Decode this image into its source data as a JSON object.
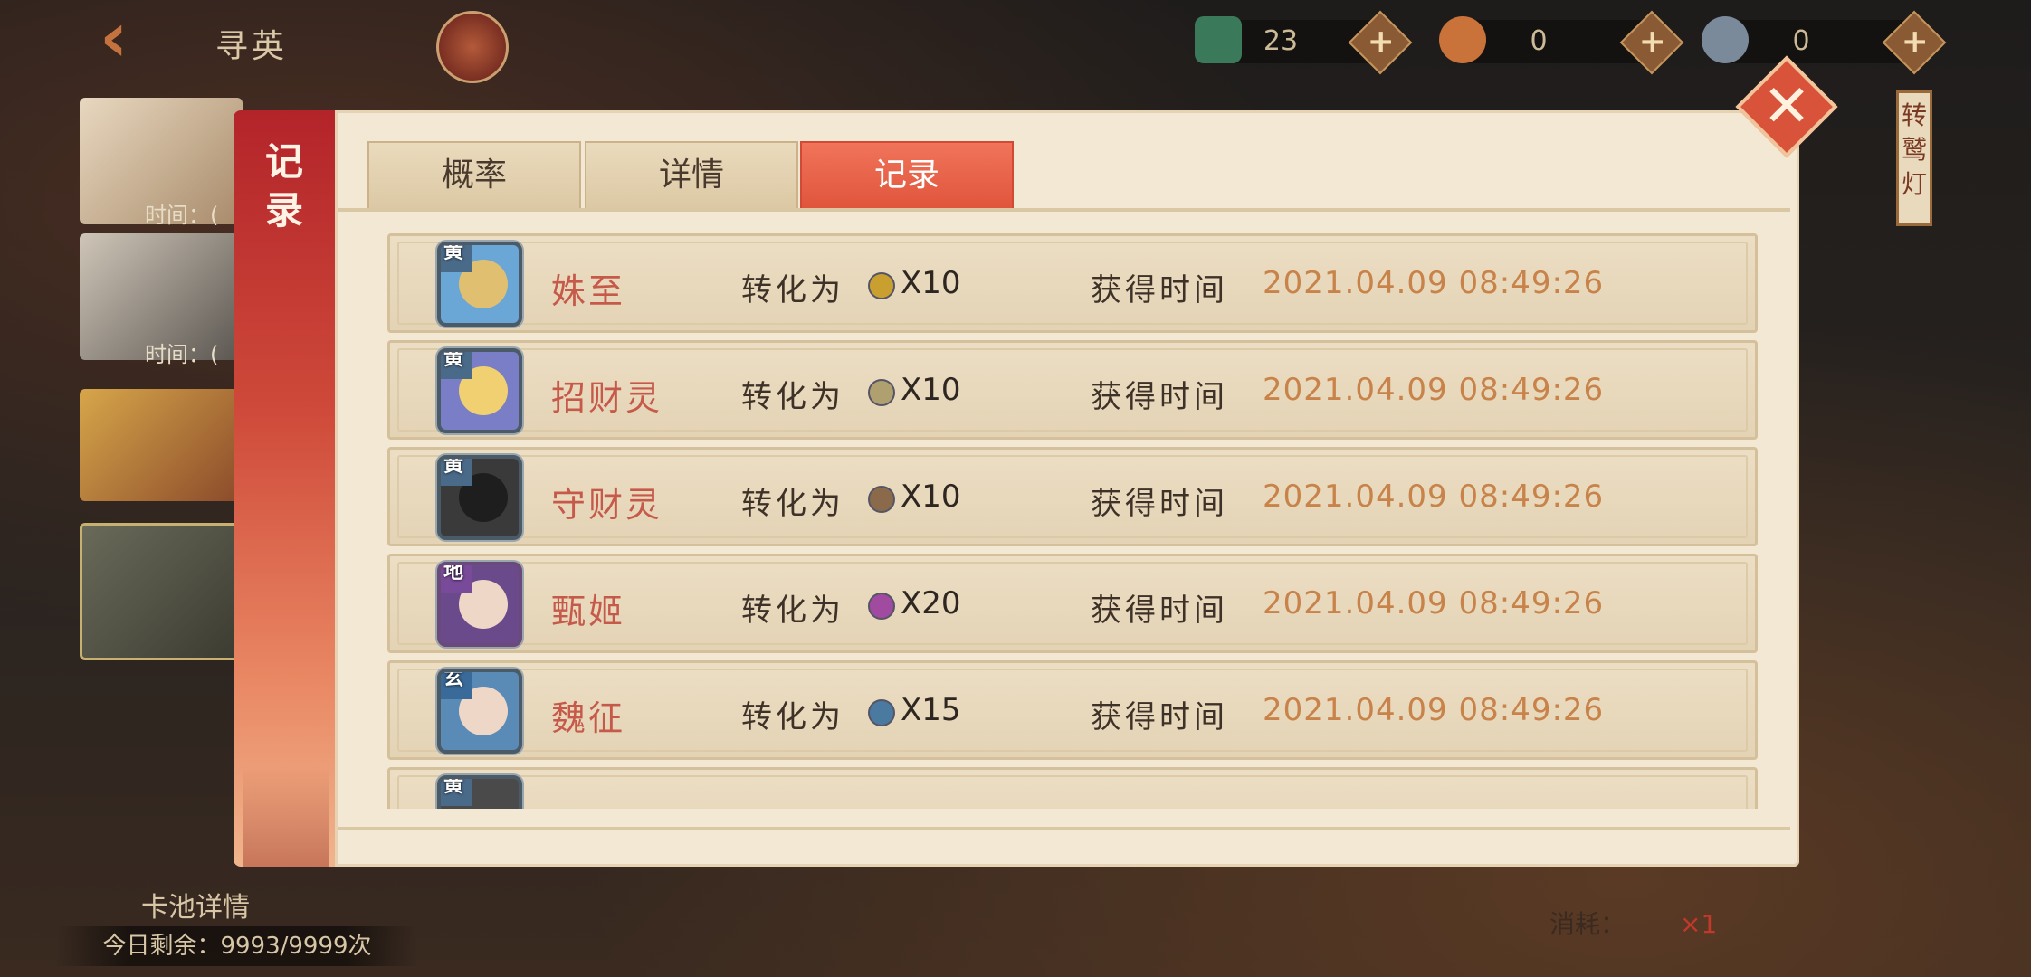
{
  "header": {
    "title": "寻英",
    "resources": [
      {
        "icon": "jade-token-icon",
        "value": "23",
        "color": "#3a7a5a"
      },
      {
        "icon": "fox-spirit-icon",
        "value": "0",
        "color": "#c9733a"
      },
      {
        "icon": "cat-spirit-icon",
        "value": "0",
        "color": "#7a8a9a"
      }
    ],
    "plus_label": "+"
  },
  "sidebar": {
    "time_label_1": "时间：(",
    "time_label_2": "时间：("
  },
  "right_deco": {
    "label": "转\n鹫\n灯"
  },
  "bottom": {
    "card_pool_label": "卡池详情",
    "remaining": "今日剩余：9993/9999次",
    "consume_label": "消耗：",
    "consume_count": "×1"
  },
  "modal": {
    "side_title": "记\n录",
    "close_symbol": "✕",
    "tabs": [
      {
        "label": "概率",
        "active": false
      },
      {
        "label": "详情",
        "active": false
      },
      {
        "label": "记录",
        "active": true
      }
    ],
    "records": [
      {
        "rarity": "黄",
        "name": "姝至",
        "convert_label": "转化为",
        "qty": "X10",
        "time_label": "获得时间",
        "date": "2021.04.09  08:49:26",
        "avatar_color": "#6aa6d6",
        "gem_color": "#c9a030"
      },
      {
        "rarity": "黄",
        "name": "招财灵",
        "convert_label": "转化为",
        "qty": "X10",
        "time_label": "获得时间",
        "date": "2021.04.09  08:49:26",
        "avatar_color": "#7a7ec6",
        "gem_color": "#b0a070"
      },
      {
        "rarity": "黄",
        "name": "守财灵",
        "convert_label": "转化为",
        "qty": "X10",
        "time_label": "获得时间",
        "date": "2021.04.09  08:49:26",
        "avatar_color": "#3a3a3a",
        "gem_color": "#8a6a4a"
      },
      {
        "rarity": "地",
        "name": "甄姬",
        "convert_label": "转化为",
        "qty": "X20",
        "time_label": "获得时间",
        "date": "2021.04.09  08:49:26",
        "avatar_color": "#6a4a8a",
        "gem_color": "#a04aa0"
      },
      {
        "rarity": "玄",
        "name": "魏征",
        "convert_label": "转化为",
        "qty": "X15",
        "time_label": "获得时间",
        "date": "2021.04.09  08:49:26",
        "avatar_color": "#5a8ab6",
        "gem_color": "#4a7aa0"
      },
      {
        "rarity": "黄",
        "name": "",
        "convert_label": "",
        "qty": "",
        "time_label": "",
        "date": "",
        "avatar_color": "#4a4a4a",
        "gem_color": ""
      }
    ]
  }
}
